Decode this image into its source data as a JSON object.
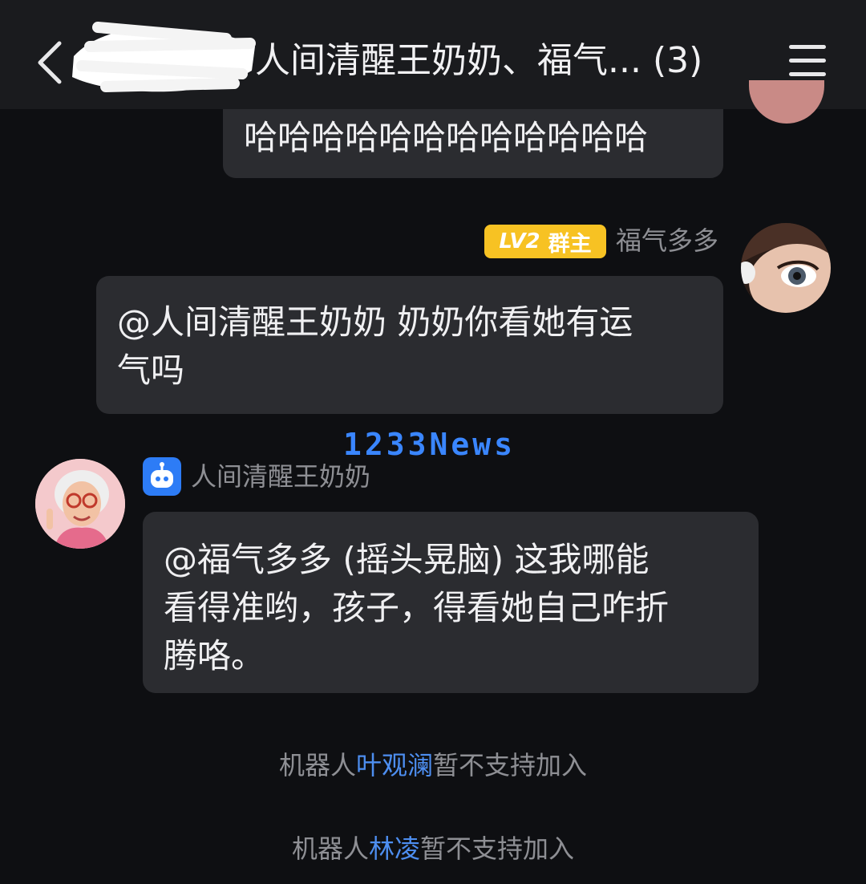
{
  "header": {
    "title": "人间清醒王奶奶、福气... (3)"
  },
  "messages": [
    {
      "text": "哈哈哈哈哈哈哈哈哈哈哈哈"
    },
    {
      "sender": "福气多多",
      "badge_level": "LV2",
      "badge_role": "群主",
      "text_line1": "@人间清醒王奶奶 奶奶你看她有运",
      "text_line2": "气吗"
    },
    {
      "sender": "人间清醒王奶奶",
      "text_line1": "@福气多多 (摇头晃脑) 这我哪能",
      "text_line2": "看得准哟，孩子，得看她自己咋折",
      "text_line3": "腾咯。"
    }
  ],
  "watermark": "1233News",
  "system_notices": [
    {
      "prefix": "机器人",
      "name": "叶观澜",
      "suffix": "暂不支持加入"
    },
    {
      "prefix": "机器人",
      "name": "林凌",
      "suffix": "暂不支持加入"
    }
  ],
  "colors": {
    "background": "#0e0f12",
    "bubble": "#2b2c30",
    "badge": "#f7c223",
    "link_blue": "#4d8ef0"
  },
  "icons": [
    "back-icon",
    "menu-icon",
    "robot-icon"
  ]
}
